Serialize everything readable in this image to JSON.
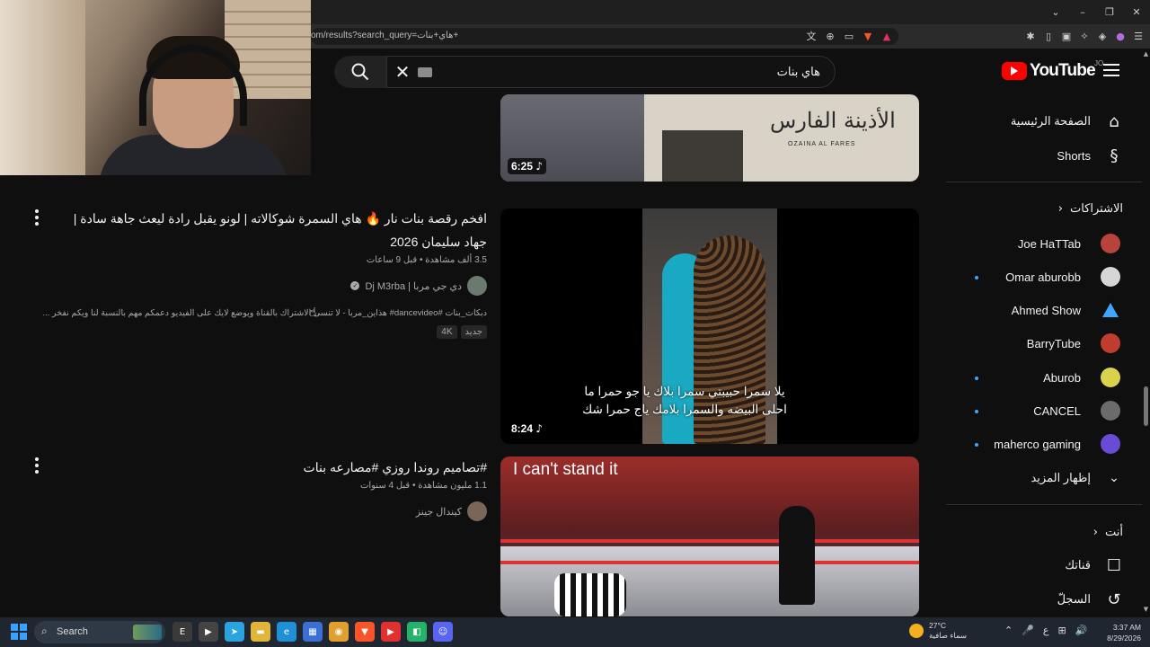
{
  "browser": {
    "url": "om/results?search_query=هاي+بنات+",
    "window_controls": [
      "⌄",
      "–",
      "❐",
      "✕"
    ],
    "url_icons": [
      "translate-icon",
      "zoom-icon",
      "cast-icon",
      "brave-shield-icon",
      "brave-rewards-icon"
    ],
    "extension_icons": [
      "extensions-icon",
      "sidebar-icon",
      "wallet-icon",
      "leo-icon",
      "vpn-icon",
      "profile-icon",
      "menu-icon"
    ]
  },
  "search": {
    "query": "هاي بنات",
    "clear_symbol": "✕"
  },
  "sidebar": {
    "brand": "YouTube",
    "region": "JO",
    "nav": [
      {
        "label": "الصفحة الرئيسية",
        "icon": "⌂"
      },
      {
        "label": "Shorts",
        "icon": "§"
      }
    ],
    "subscriptions_header": "الاشتراكات",
    "subscriptions": [
      {
        "name": "Joe HaTTab",
        "new": false,
        "color": "#b8433a"
      },
      {
        "name": "Omar aburobb",
        "new": true,
        "color": "#d6d6d6"
      },
      {
        "name": "Ahmed Show",
        "new": false,
        "color": "#3ea6ff"
      },
      {
        "name": "BarryTube",
        "new": false,
        "color": "#c23b2f"
      },
      {
        "name": "Aburob",
        "new": true,
        "color": "#d9d34b"
      },
      {
        "name": "CANCEL",
        "new": true,
        "color": "#6b6b6b"
      },
      {
        "name": "maherco gaming",
        "new": true,
        "color": "#6a4bd6"
      }
    ],
    "show_more": "إظهار المزيد",
    "you_header": "أنت",
    "you_items": [
      {
        "label": "قناتك",
        "icon": "☐"
      },
      {
        "label": "السجلّ",
        "icon": "↺"
      }
    ]
  },
  "videos": [
    {
      "duration": "6:25",
      "brand_ar": "الأذينة الفارس",
      "brand_en": "OZAINA AL FARES"
    },
    {
      "title": "افخم رقصة بنات نار 🔥 هاي السمرة شوكالاته | لونو يقبل رادة ليعث جاهة سادة | جهاد سليمان 2026",
      "stats": "3.5 ألف مشاهدة • قبل 9 ساعات",
      "channel": "دي جي مربا | Dj M3rba",
      "verified": true,
      "description": "دبكات_بنات #dancevideo# هذاين_مربا - لا تنسى الاشتراك بالقناة ويوضع لايك على الفيديو دعمكم مهم بالنسبة لنا ويكم نفخر ...",
      "badges": [
        "جديد",
        "4K"
      ],
      "duration": "8:24",
      "caption_line1": "يلا سمرا حبيبتي سمرا بلاك يا جو حمرا ما",
      "caption_line2": "احلى البيضه والسمرا بلامك ياج حمرا شك"
    },
    {
      "title": "#تصاميم روندا روزي #مصارعه بنات",
      "stats": "1.1 مليون مشاهدة • قبل 4 سنوات",
      "channel": "كيندال جينز",
      "caption": "I can't stand it"
    }
  ],
  "taskbar": {
    "search_label": "Search",
    "weather_temp": "27°C",
    "weather_desc": "سماء صافية",
    "time": "3:37 AM",
    "date": "8/29/2026",
    "apps": [
      {
        "name": "epic-icon",
        "color": "#3a3a3a",
        "glyph": "E"
      },
      {
        "name": "media-icon",
        "color": "#444",
        "glyph": "▶"
      },
      {
        "name": "telegram-icon",
        "color": "#2aa3df",
        "glyph": "➤"
      },
      {
        "name": "folder-icon",
        "color": "#e0b53a",
        "glyph": "▬"
      },
      {
        "name": "edge-icon",
        "color": "#1f8fd6",
        "glyph": "e"
      },
      {
        "name": "store-icon",
        "color": "#3a6fd6",
        "glyph": "▦"
      },
      {
        "name": "chrome-icon",
        "color": "#e0a030",
        "glyph": "◉"
      },
      {
        "name": "brave-icon",
        "color": "#fb542b",
        "glyph": "▼"
      },
      {
        "name": "youtube-app-icon",
        "color": "#e03030",
        "glyph": "▶"
      },
      {
        "name": "game-icon",
        "color": "#27b26a",
        "glyph": "◧"
      },
      {
        "name": "discord-icon",
        "color": "#5865f2",
        "glyph": "☺"
      }
    ],
    "tray": [
      "⌃",
      "🎤",
      "ع",
      "⊞",
      "🔊"
    ]
  }
}
